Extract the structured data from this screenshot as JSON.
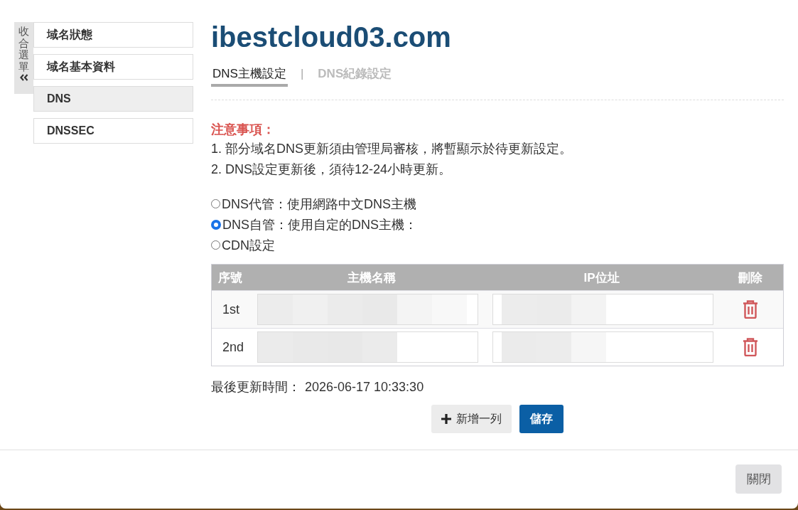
{
  "sidebar": {
    "collapse_label": "收合選單",
    "items": [
      {
        "label": "域名狀態",
        "selected": false
      },
      {
        "label": "域名基本資料",
        "selected": false
      },
      {
        "label": "DNS",
        "selected": true
      },
      {
        "label": "DNSSEC",
        "selected": false
      }
    ]
  },
  "domain_title": "ibestcloud03.com",
  "tabs": [
    {
      "label": "DNS主機設定",
      "selected": true
    },
    {
      "label": "DNS紀錄設定",
      "selected": false
    }
  ],
  "tab_separator": "|",
  "notice": {
    "title": "注意事項：",
    "lines": [
      "1. 部分域名DNS更新須由管理局審核，將暫顯示於待更新設定。",
      "2. DNS設定更新後，須待12-24小時更新。"
    ]
  },
  "dns_options": [
    {
      "label": "DNS代管：使用網路中文DNS主機",
      "selected": false
    },
    {
      "label": "DNS自管：使用自定的DNS主機：",
      "selected": true
    },
    {
      "label": "CDN設定",
      "selected": false
    }
  ],
  "table": {
    "columns": [
      "序號",
      "主機名稱",
      "IP位址",
      "刪除"
    ],
    "rows": [
      {
        "index": "1st",
        "redacted": true
      },
      {
        "index": "2nd",
        "redacted": true
      }
    ]
  },
  "last_updated": {
    "label": "最後更新時間：",
    "value": "2026-06-17 10:33:30"
  },
  "buttons": [
    {
      "label": "新增一列",
      "kind": "add"
    },
    {
      "label": "儲存",
      "kind": "primary"
    }
  ],
  "footer": {
    "close_label": "關閉"
  }
}
